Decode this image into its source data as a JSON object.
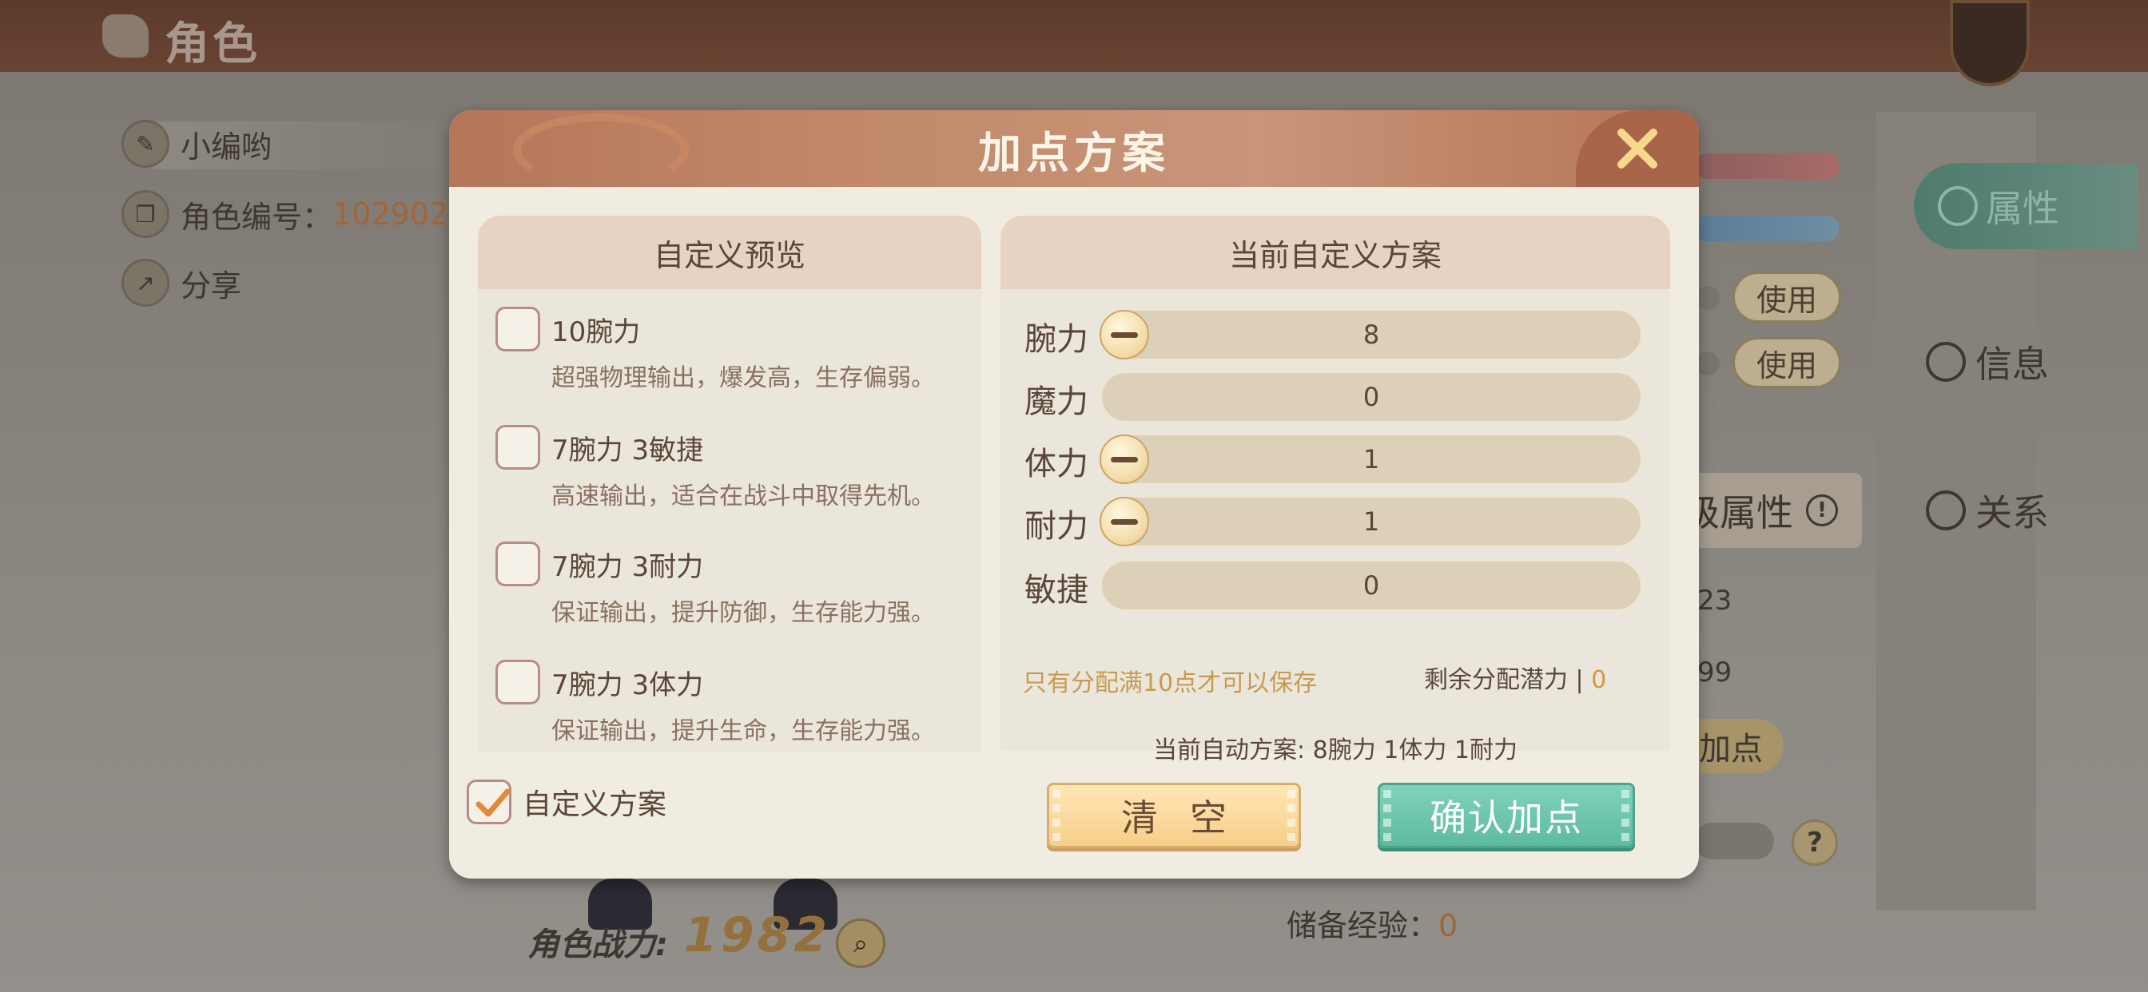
{
  "background": {
    "screen_title": "角色",
    "character_name": "小编哟",
    "character_id_label": "角色编号：",
    "character_id_value": "102902",
    "share_label": "分享",
    "tabs": {
      "attributes": "属性",
      "info": "信息",
      "relations": "关系"
    },
    "use_button_1": "使用",
    "use_button_2": "使用",
    "advanced_attr_fragment": "级属性",
    "num_fragment_1": "23",
    "num_fragment_2": "99",
    "add_point_fragment": "加点",
    "help_glyph": "?",
    "reserve_exp_label": "储备经验：",
    "reserve_exp_value": "0",
    "power_label": "角色战力:",
    "power_value": "1982"
  },
  "dialog": {
    "title": "加点方案",
    "left_panel": {
      "header": "自定义预览",
      "presets": [
        {
          "title": "10腕力",
          "desc": "超强物理输出，爆发高，生存偏弱。",
          "checked": false
        },
        {
          "title": "7腕力  3敏捷",
          "desc": "高速输出，适合在战斗中取得先机。",
          "checked": false
        },
        {
          "title": "7腕力  3耐力",
          "desc": "保证输出，提升防御，生存能力强。",
          "checked": false
        },
        {
          "title": "7腕力  3体力",
          "desc": "保证输出，提升生命，生存能力强。",
          "checked": false
        }
      ],
      "custom_label": "自定义方案",
      "custom_checked": true
    },
    "right_panel": {
      "header": "当前自定义方案",
      "stats": [
        {
          "label": "腕力",
          "value": "8",
          "has_minus": true
        },
        {
          "label": "魔力",
          "value": "0",
          "has_minus": false
        },
        {
          "label": "体力",
          "value": "1",
          "has_minus": true
        },
        {
          "label": "耐力",
          "value": "1",
          "has_minus": true
        },
        {
          "label": "敏捷",
          "value": "0",
          "has_minus": false
        }
      ],
      "hint": "只有分配满10点才可以保存",
      "remaining_label": "剩余分配潜力 | ",
      "remaining_value": "0",
      "auto_plan": "当前自动方案: 8腕力  1体力  1耐力"
    },
    "buttons": {
      "clear": "清空",
      "confirm": "确认加点"
    }
  },
  "colors": {
    "header": "#c28a6c",
    "close": "#a8654a",
    "confirm": "#5ebb9f",
    "clear": "#f6cf8a",
    "hint": "#c89a4f"
  }
}
